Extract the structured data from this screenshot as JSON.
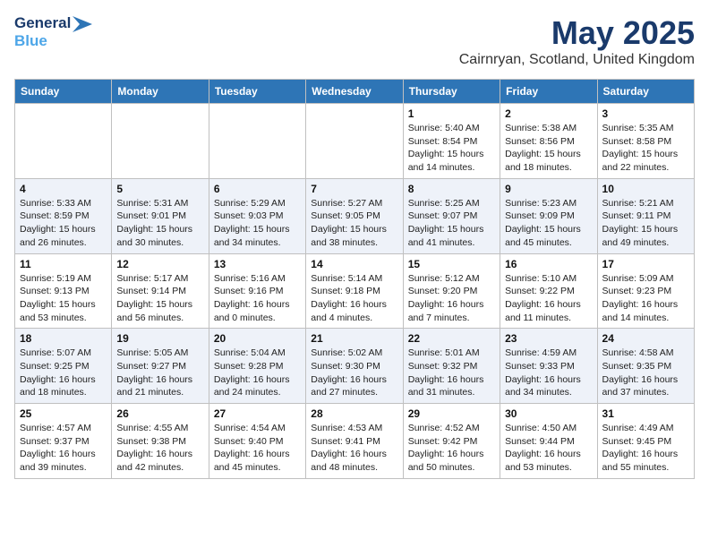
{
  "logo": {
    "line1": "General",
    "line2": "Blue",
    "arrow_color": "#4da6e8"
  },
  "title": "May 2025",
  "location": "Cairnryan, Scotland, United Kingdom",
  "weekdays": [
    "Sunday",
    "Monday",
    "Tuesday",
    "Wednesday",
    "Thursday",
    "Friday",
    "Saturday"
  ],
  "weeks": [
    [
      {
        "day": "",
        "info": ""
      },
      {
        "day": "",
        "info": ""
      },
      {
        "day": "",
        "info": ""
      },
      {
        "day": "",
        "info": ""
      },
      {
        "day": "1",
        "info": "Sunrise: 5:40 AM\nSunset: 8:54 PM\nDaylight: 15 hours\nand 14 minutes."
      },
      {
        "day": "2",
        "info": "Sunrise: 5:38 AM\nSunset: 8:56 PM\nDaylight: 15 hours\nand 18 minutes."
      },
      {
        "day": "3",
        "info": "Sunrise: 5:35 AM\nSunset: 8:58 PM\nDaylight: 15 hours\nand 22 minutes."
      }
    ],
    [
      {
        "day": "4",
        "info": "Sunrise: 5:33 AM\nSunset: 8:59 PM\nDaylight: 15 hours\nand 26 minutes."
      },
      {
        "day": "5",
        "info": "Sunrise: 5:31 AM\nSunset: 9:01 PM\nDaylight: 15 hours\nand 30 minutes."
      },
      {
        "day": "6",
        "info": "Sunrise: 5:29 AM\nSunset: 9:03 PM\nDaylight: 15 hours\nand 34 minutes."
      },
      {
        "day": "7",
        "info": "Sunrise: 5:27 AM\nSunset: 9:05 PM\nDaylight: 15 hours\nand 38 minutes."
      },
      {
        "day": "8",
        "info": "Sunrise: 5:25 AM\nSunset: 9:07 PM\nDaylight: 15 hours\nand 41 minutes."
      },
      {
        "day": "9",
        "info": "Sunrise: 5:23 AM\nSunset: 9:09 PM\nDaylight: 15 hours\nand 45 minutes."
      },
      {
        "day": "10",
        "info": "Sunrise: 5:21 AM\nSunset: 9:11 PM\nDaylight: 15 hours\nand 49 minutes."
      }
    ],
    [
      {
        "day": "11",
        "info": "Sunrise: 5:19 AM\nSunset: 9:13 PM\nDaylight: 15 hours\nand 53 minutes."
      },
      {
        "day": "12",
        "info": "Sunrise: 5:17 AM\nSunset: 9:14 PM\nDaylight: 15 hours\nand 56 minutes."
      },
      {
        "day": "13",
        "info": "Sunrise: 5:16 AM\nSunset: 9:16 PM\nDaylight: 16 hours\nand 0 minutes."
      },
      {
        "day": "14",
        "info": "Sunrise: 5:14 AM\nSunset: 9:18 PM\nDaylight: 16 hours\nand 4 minutes."
      },
      {
        "day": "15",
        "info": "Sunrise: 5:12 AM\nSunset: 9:20 PM\nDaylight: 16 hours\nand 7 minutes."
      },
      {
        "day": "16",
        "info": "Sunrise: 5:10 AM\nSunset: 9:22 PM\nDaylight: 16 hours\nand 11 minutes."
      },
      {
        "day": "17",
        "info": "Sunrise: 5:09 AM\nSunset: 9:23 PM\nDaylight: 16 hours\nand 14 minutes."
      }
    ],
    [
      {
        "day": "18",
        "info": "Sunrise: 5:07 AM\nSunset: 9:25 PM\nDaylight: 16 hours\nand 18 minutes."
      },
      {
        "day": "19",
        "info": "Sunrise: 5:05 AM\nSunset: 9:27 PM\nDaylight: 16 hours\nand 21 minutes."
      },
      {
        "day": "20",
        "info": "Sunrise: 5:04 AM\nSunset: 9:28 PM\nDaylight: 16 hours\nand 24 minutes."
      },
      {
        "day": "21",
        "info": "Sunrise: 5:02 AM\nSunset: 9:30 PM\nDaylight: 16 hours\nand 27 minutes."
      },
      {
        "day": "22",
        "info": "Sunrise: 5:01 AM\nSunset: 9:32 PM\nDaylight: 16 hours\nand 31 minutes."
      },
      {
        "day": "23",
        "info": "Sunrise: 4:59 AM\nSunset: 9:33 PM\nDaylight: 16 hours\nand 34 minutes."
      },
      {
        "day": "24",
        "info": "Sunrise: 4:58 AM\nSunset: 9:35 PM\nDaylight: 16 hours\nand 37 minutes."
      }
    ],
    [
      {
        "day": "25",
        "info": "Sunrise: 4:57 AM\nSunset: 9:37 PM\nDaylight: 16 hours\nand 39 minutes."
      },
      {
        "day": "26",
        "info": "Sunrise: 4:55 AM\nSunset: 9:38 PM\nDaylight: 16 hours\nand 42 minutes."
      },
      {
        "day": "27",
        "info": "Sunrise: 4:54 AM\nSunset: 9:40 PM\nDaylight: 16 hours\nand 45 minutes."
      },
      {
        "day": "28",
        "info": "Sunrise: 4:53 AM\nSunset: 9:41 PM\nDaylight: 16 hours\nand 48 minutes."
      },
      {
        "day": "29",
        "info": "Sunrise: 4:52 AM\nSunset: 9:42 PM\nDaylight: 16 hours\nand 50 minutes."
      },
      {
        "day": "30",
        "info": "Sunrise: 4:50 AM\nSunset: 9:44 PM\nDaylight: 16 hours\nand 53 minutes."
      },
      {
        "day": "31",
        "info": "Sunrise: 4:49 AM\nSunset: 9:45 PM\nDaylight: 16 hours\nand 55 minutes."
      }
    ]
  ]
}
